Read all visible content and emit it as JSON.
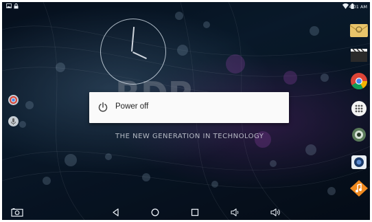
{
  "status_bar": {
    "time": "4:01 AM",
    "left_icons": [
      "image-notification-icon",
      "lock-notification-icon"
    ],
    "right_icons": [
      "wifi-icon",
      "battery-icon"
    ]
  },
  "wallpaper": {
    "brand_text": "THE NEW GENERATION IN TECHNOLOGY"
  },
  "power_menu": {
    "items": [
      {
        "label": "Power off",
        "icon": "power-icon"
      }
    ]
  },
  "left_shortcuts": [
    "chrome-icon",
    "microphone-icon"
  ],
  "dock_apps": [
    "email-icon",
    "video-icon",
    "chrome-icon",
    "app-drawer-icon",
    "camera-lens-icon",
    "camera-icon",
    "music-icon"
  ],
  "navigation_bar": {
    "buttons": [
      "screenshot-icon",
      "back-icon",
      "home-icon",
      "recents-icon",
      "volume-down-icon",
      "volume-up-icon"
    ]
  },
  "colors": {
    "dialog_background": "#fafafa",
    "dialog_text": "#222222",
    "wallpaper_dark": "#0a1a2e",
    "wallpaper_purple": "#a040c0"
  }
}
